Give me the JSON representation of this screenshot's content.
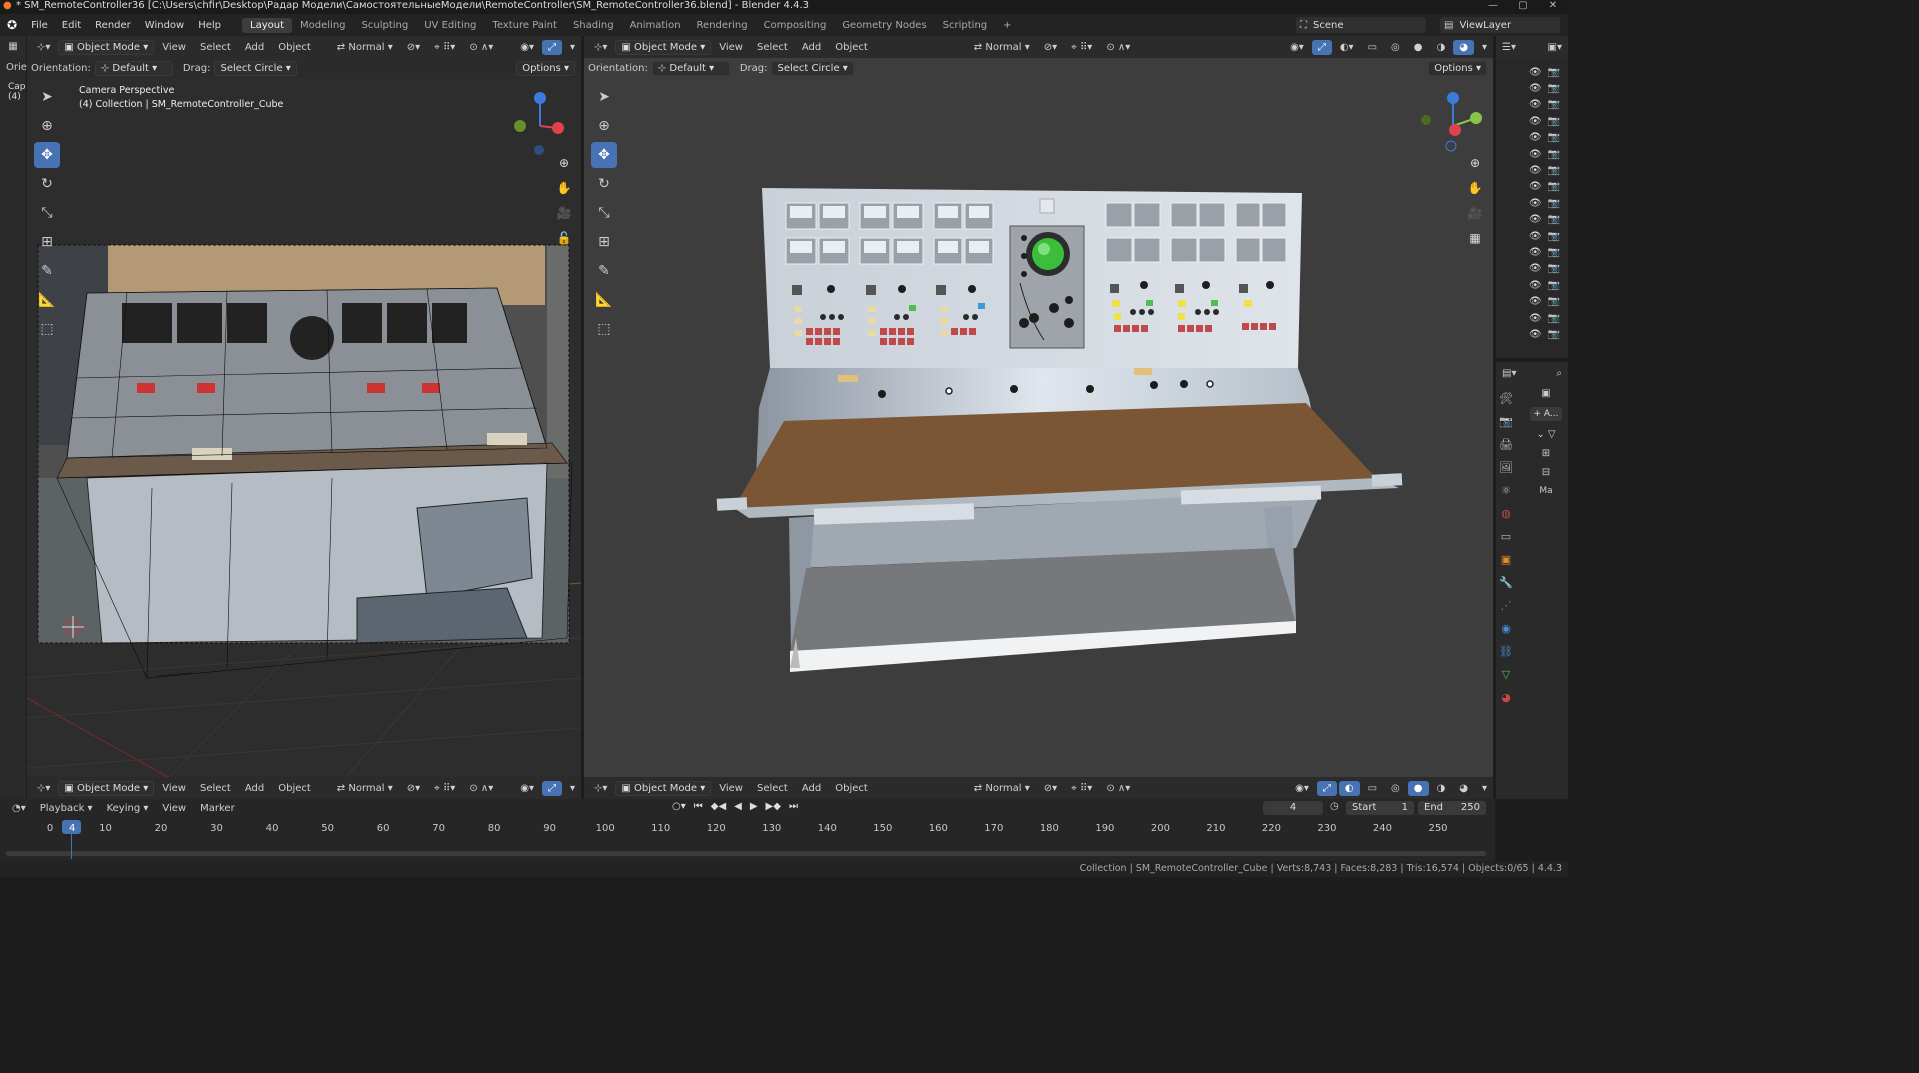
{
  "window": {
    "title": "* SM_RemoteController36 [C:\\Users\\chfir\\Desktop\\Радар Модели\\СамостоятельныеМодели\\RemoteController\\SM_RemoteController36.blend] - Blender 4.4.3",
    "min": "—",
    "max": "▢",
    "close": "✕"
  },
  "menu": [
    "File",
    "Edit",
    "Render",
    "Window",
    "Help"
  ],
  "workspaces": [
    {
      "label": "Layout",
      "active": true
    },
    {
      "label": "Modeling",
      "active": false
    },
    {
      "label": "Sculpting",
      "active": false
    },
    {
      "label": "UV Editing",
      "active": false
    },
    {
      "label": "Texture Paint",
      "active": false
    },
    {
      "label": "Shading",
      "active": false
    },
    {
      "label": "Animation",
      "active": false
    },
    {
      "label": "Rendering",
      "active": false
    },
    {
      "label": "Compositing",
      "active": false
    },
    {
      "label": "Geometry Nodes",
      "active": false
    },
    {
      "label": "Scripting",
      "active": false
    }
  ],
  "add_workspace": "+",
  "scene": {
    "label": "Scene",
    "viewlayer": "ViewLayer"
  },
  "viewport_left": {
    "mode": "Object Mode",
    "menus": [
      "View",
      "Select",
      "Add",
      "Object"
    ],
    "orientation_short": "Orie",
    "transform": "Normal",
    "orientation_label": "Orientation:",
    "orientation_value": "Default",
    "drag_label": "Drag:",
    "drag_value": "Select Circle",
    "options": "Options",
    "overlay_line1": "Camera Perspective",
    "overlay_line2": "(4) Collection | SM_RemoteController_Cube"
  },
  "viewport_right": {
    "mode": "Object Mode",
    "menus": [
      "View",
      "Select",
      "Add",
      "Object"
    ],
    "transform": "Normal",
    "orientation_label": "Orientation:",
    "orientation_value": "Default",
    "drag_label": "Drag:",
    "drag_value": "Select Circle",
    "options": "Options"
  },
  "side_sliver": {
    "line1": "Cap",
    "line2": "(4)"
  },
  "properties": {
    "add_label": "+ A...",
    "ma_label": "Ma"
  },
  "timeline": {
    "menus": [
      "Playback",
      "Keying",
      "View",
      "Marker"
    ],
    "current_frame": "4",
    "start_label": "Start",
    "start_value": "1",
    "end_label": "End",
    "end_value": "250",
    "ticks": [
      "0",
      "4",
      "10",
      "20",
      "30",
      "40",
      "50",
      "60",
      "70",
      "80",
      "90",
      "100",
      "110",
      "120",
      "130",
      "140",
      "150",
      "160",
      "170",
      "180",
      "190",
      "200",
      "210",
      "220",
      "230",
      "240",
      "250"
    ]
  },
  "status_bar": "Collection | SM_RemoteController_Cube | Verts:8,743 | Faces:8,283 | Tris:16,574 | Objects:0/65 | 4.4.3",
  "colors": {
    "accent": "#4772b3",
    "axis_x": "#e0414f",
    "axis_y": "#8bc34a",
    "axis_z": "#3a7bdc",
    "wood": "#7a5634",
    "panel": "#cdd4dc"
  }
}
